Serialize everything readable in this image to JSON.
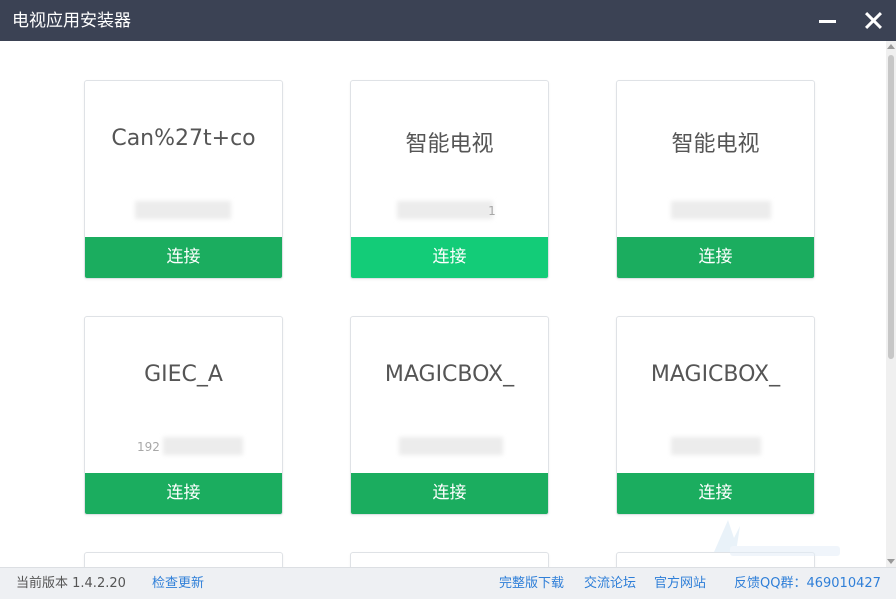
{
  "window": {
    "title": "电视应用安装器"
  },
  "devices": [
    {
      "name": "Can%27t+co",
      "ip": "",
      "connect_label": "连接"
    },
    {
      "name": "智能电视",
      "ip": "1",
      "connect_label": "连接"
    },
    {
      "name": "智能电视",
      "ip": "",
      "connect_label": "连接"
    },
    {
      "name": "GIEC_A",
      "ip": "192",
      "connect_label": "连接"
    },
    {
      "name": "MAGICBOX_",
      "ip": "",
      "connect_label": "连接"
    },
    {
      "name": "MAGICBOX_",
      "ip": "",
      "connect_label": "连接"
    }
  ],
  "status": {
    "version_label": "当前版本 1.4.2.20",
    "check_update": "检查更新",
    "full_download": "完整版下载",
    "forum": "交流论坛",
    "website": "官方网站",
    "feedback_qq": "反馈QQ群：469010427"
  },
  "colors": {
    "titlebar": "#3b4254",
    "button": "#1bad5f",
    "button_hover": "#13cc78",
    "link": "#2f7fd8"
  }
}
